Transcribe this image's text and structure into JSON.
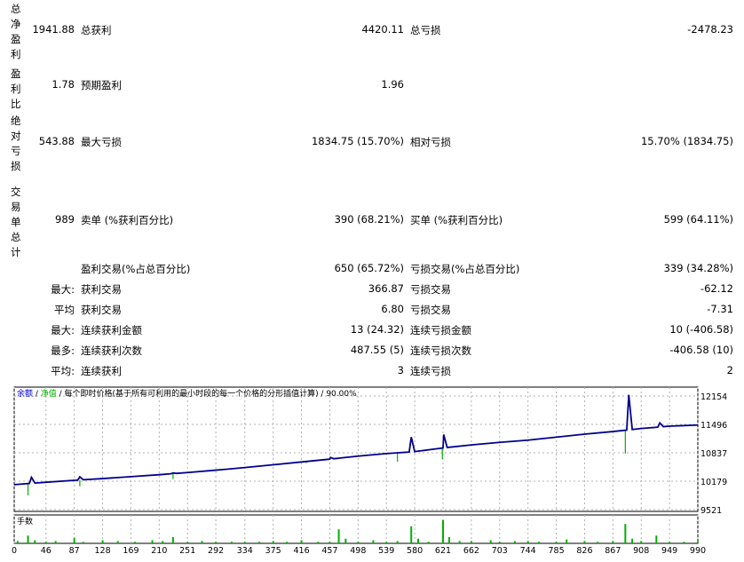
{
  "report": {
    "rows": [
      {
        "label": "总净盈利",
        "v1": "1941.88",
        "l2": "总获利",
        "v2": "4420.11",
        "l3": "总亏损",
        "v3": "-2478.23"
      },
      {
        "label": "盈利比",
        "v1": "1.78",
        "l2": "预期盈利",
        "v2": "1.96",
        "l3": "",
        "v3": ""
      },
      {
        "label": "绝对亏损",
        "v1": "543.88",
        "l2": "最大亏损",
        "v2": "1834.75 (15.70%)",
        "l3": "相对亏损",
        "v3": "15.70% (1834.75)"
      },
      {
        "label": "交易单总计",
        "v1": "989",
        "l2": "卖单 (%获利百分比)",
        "v2": "390 (68.21%)",
        "l3": "买单 (%获利百分比)",
        "v3": "599 (64.11%)"
      }
    ],
    "stats": [
      {
        "k": "",
        "l2": "盈利交易(%占总百分比)",
        "v2": "650 (65.72%)",
        "l3": "亏损交易(%占总百分比)",
        "v3": "339 (34.28%)"
      },
      {
        "k": "最大:",
        "l2": "获利交易",
        "v2": "366.87",
        "l3": "亏损交易",
        "v3": "-62.12"
      },
      {
        "k": "平均",
        "l2": "获利交易",
        "v2": "6.80",
        "l3": "亏损交易",
        "v3": "-7.31"
      },
      {
        "k": "最大:",
        "l2": "连续获利金额",
        "v2": "13 (24.32)",
        "l3": "连续亏损金额",
        "v3": "10 (-406.58)"
      },
      {
        "k": "最多:",
        "l2": "连续获利次数",
        "v2": "487.55 (5)",
        "l3": "连续亏损次数",
        "v3": "-406.58 (10)"
      },
      {
        "k": "平均:",
        "l2": "连续获利",
        "v2": "3",
        "l3": "连续亏损",
        "v3": "2"
      }
    ]
  },
  "chart_data": {
    "type": "line",
    "header": {
      "balance": "余额",
      "sep1": " / ",
      "equity": "净值",
      "rest": " / 每个即时价格(基于所有可利用的最小时段的每一个价格的分形插值计算) / 90.00%"
    },
    "colors": {
      "balance": "#00008b",
      "equity": "#00b000",
      "volume": "#00b000",
      "grid": "#b0b0b0",
      "frame": "#000000",
      "header": "#0000cc"
    },
    "yticks": [
      12154,
      11496,
      10837,
      10179,
      9521
    ],
    "ylim": [
      9521,
      12154
    ],
    "xticks": [
      0,
      46,
      87,
      128,
      169,
      210,
      251,
      292,
      334,
      375,
      416,
      457,
      498,
      539,
      580,
      621,
      662,
      703,
      744,
      785,
      826,
      867,
      908,
      949,
      990
    ],
    "xlim": [
      0,
      990
    ],
    "volume_label": "手数",
    "balance": [
      [
        0,
        10100
      ],
      [
        46,
        10155
      ],
      [
        87,
        10200
      ],
      [
        128,
        10240
      ],
      [
        169,
        10285
      ],
      [
        210,
        10330
      ],
      [
        251,
        10380
      ],
      [
        292,
        10435
      ],
      [
        334,
        10495
      ],
      [
        375,
        10560
      ],
      [
        416,
        10625
      ],
      [
        457,
        10690
      ],
      [
        498,
        10760
      ],
      [
        539,
        10820
      ],
      [
        580,
        10865
      ],
      [
        621,
        10950
      ],
      [
        662,
        11020
      ],
      [
        703,
        11080
      ],
      [
        744,
        11130
      ],
      [
        785,
        11200
      ],
      [
        826,
        11270
      ],
      [
        867,
        11330
      ],
      [
        908,
        11400
      ],
      [
        949,
        11455
      ],
      [
        990,
        11480
      ]
    ],
    "equity_spikes": [
      [
        20,
        9850
      ],
      [
        95,
        10060
      ],
      [
        230,
        10230
      ],
      [
        423,
        10600
      ],
      [
        555,
        10630
      ],
      [
        620,
        10690
      ],
      [
        885,
        10820
      ],
      [
        925,
        11400
      ]
    ],
    "balance_spikes": [
      [
        25,
        10270
      ],
      [
        95,
        10280
      ],
      [
        230,
        10370
      ],
      [
        458,
        10730
      ],
      [
        575,
        11200
      ],
      [
        622,
        11260
      ],
      [
        890,
        12180
      ],
      [
        935,
        11530
      ]
    ],
    "volume": [
      [
        5,
        3
      ],
      [
        20,
        10
      ],
      [
        30,
        4
      ],
      [
        46,
        2
      ],
      [
        60,
        3
      ],
      [
        87,
        7
      ],
      [
        100,
        2
      ],
      [
        128,
        4
      ],
      [
        150,
        3
      ],
      [
        175,
        2
      ],
      [
        200,
        4
      ],
      [
        215,
        3
      ],
      [
        230,
        8
      ],
      [
        251,
        2
      ],
      [
        272,
        3
      ],
      [
        292,
        2
      ],
      [
        315,
        2
      ],
      [
        334,
        2
      ],
      [
        355,
        2
      ],
      [
        375,
        3
      ],
      [
        395,
        2
      ],
      [
        416,
        4
      ],
      [
        440,
        2
      ],
      [
        457,
        2
      ],
      [
        470,
        18
      ],
      [
        480,
        6
      ],
      [
        498,
        2
      ],
      [
        520,
        4
      ],
      [
        539,
        2
      ],
      [
        555,
        3
      ],
      [
        575,
        22
      ],
      [
        585,
        6
      ],
      [
        600,
        2
      ],
      [
        621,
        30
      ],
      [
        630,
        8
      ],
      [
        645,
        3
      ],
      [
        662,
        3
      ],
      [
        690,
        4
      ],
      [
        703,
        2
      ],
      [
        725,
        3
      ],
      [
        744,
        3
      ],
      [
        760,
        2
      ],
      [
        785,
        2
      ],
      [
        800,
        5
      ],
      [
        826,
        3
      ],
      [
        845,
        2
      ],
      [
        867,
        3
      ],
      [
        885,
        25
      ],
      [
        895,
        6
      ],
      [
        908,
        3
      ],
      [
        930,
        10
      ],
      [
        949,
        2
      ],
      [
        970,
        2
      ],
      [
        990,
        2
      ]
    ]
  }
}
